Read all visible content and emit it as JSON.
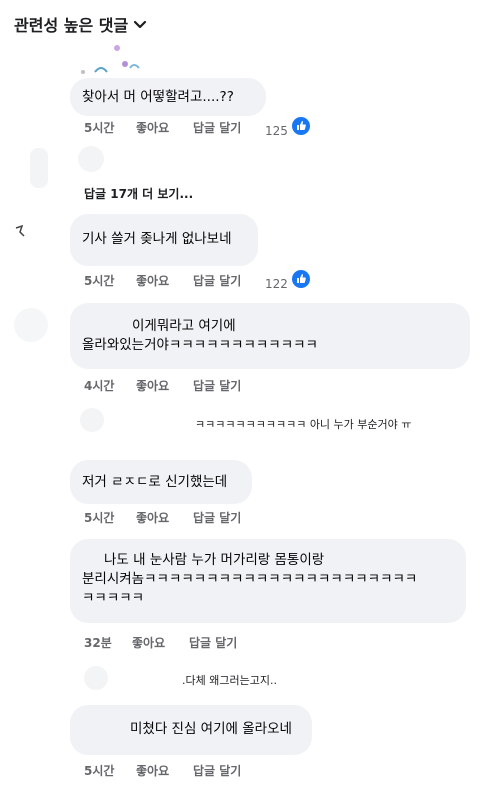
{
  "header": {
    "title": "관련성 높은 댓글"
  },
  "actions": {
    "like": "좋아요",
    "reply": "답글 달기"
  },
  "comments": [
    {
      "text": "찾아서 머 어떻할려고....??",
      "time": "5시간",
      "reactions": "125"
    },
    {
      "text": "기사 쓸거 좆나게 없나보네",
      "time": "5시간",
      "reactions": "122"
    },
    {
      "text_line1": "이게뭐라고 여기에",
      "text_line2": "올라와있는거야ㅋㅋㅋㅋㅋㅋㅋㅋㅋㅋㅋㅋ",
      "time": "4시간"
    },
    {
      "text": "저거 ㄹㅈㄷ로 신기했는데",
      "time": "5시간"
    },
    {
      "text_line1": "나도 내 눈사람 누가 머가리랑 몸통이랑",
      "text_line2": "분리시켜놈ㅋㅋㅋㅋㅋㅋㅋㅋㅋㅋㅋㅋㅋㅋㅋㅋㅋㅋㅋㅋㅋㅋ",
      "text_line3": "ㅋㅋㅋㅋㅋ",
      "time": "32분"
    },
    {
      "text": "미쳤다 진심 여기에 올라오네",
      "time": "5시간"
    }
  ],
  "more_replies": "답글 17개 더 보기...",
  "preview_replies": [
    {
      "text": "ㅋㅋㅋㅋㅋㅋㅋㅋㅋㅋㅋ 아니 누가 부순거야 ㅠ"
    },
    {
      "text": ".다체 왜그러는고지.."
    }
  ],
  "colors": {
    "bubble": "#f0f2f5",
    "like_blue": "#1877f2",
    "meta": "#65676b"
  }
}
